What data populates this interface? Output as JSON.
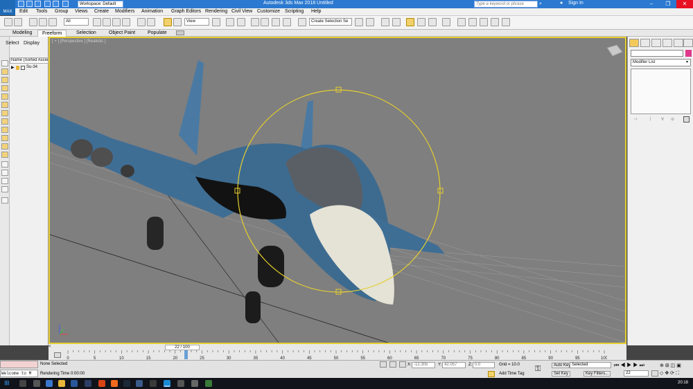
{
  "app": {
    "title": "Autodesk 3ds Max 2018    Untitled",
    "logo_text": "MAX",
    "workspace": "Workspace: Default",
    "search_placeholder": "Type a keyword or phrase",
    "sign_in": "Sign In"
  },
  "menu": [
    "Edit",
    "Tools",
    "Group",
    "Views",
    "Create",
    "Modifiers",
    "Animation",
    "Graph Editors",
    "Rendering",
    "Civil View",
    "Customize",
    "Scripting",
    "Help"
  ],
  "toolbar": {
    "selection_filter": "All",
    "ref_coord": "View",
    "named_selection": "Create Selection Se"
  },
  "ribbon_tabs": [
    "Modeling",
    "Freeform",
    "Selection",
    "Object Paint",
    "Populate"
  ],
  "ribbon_active": "Freeform",
  "scene_explorer": {
    "tabs": [
      "Select",
      "Display"
    ],
    "column_header": "Name (Sorted Ascen",
    "items": [
      {
        "name": "Su-34",
        "expanded": false
      }
    ]
  },
  "viewport": {
    "label": "[ + ] [Perspective ] [Realistic ]"
  },
  "command_panel": {
    "modifier_list": "Modifier List",
    "name_value": "",
    "object_color": "#e0398c"
  },
  "timeline": {
    "slider_label": "22 / 100",
    "current_frame": 22,
    "total_frames": 100,
    "tick_labels": [
      "0",
      "5",
      "10",
      "15",
      "20",
      "25",
      "30",
      "35",
      "40",
      "45",
      "50",
      "55",
      "60",
      "65",
      "70",
      "75",
      "80",
      "85",
      "90",
      "95",
      "100"
    ]
  },
  "status": {
    "maxscript_output": "Welcome to M",
    "selection": "None Selected",
    "rendering_time": "Rendering Time  0:00:00",
    "x_label": "X:",
    "x_value": "-12.305",
    "y_label": "Y:",
    "y_value": "42.057",
    "z_label": "Z:",
    "z_value": "0.0",
    "grid": "Grid = 10.0",
    "add_time_tag": "Add Time Tag",
    "auto_key": "Auto Key",
    "set_key": "Set Key",
    "key_mode": "Selected",
    "key_filters": "Key Filters...",
    "frame_field": "22"
  },
  "taskbar": {
    "clock": "20:18"
  },
  "colors": {
    "titlebar": "#2b79d0",
    "viewport_border": "#e6cf2e",
    "viewport_bg": "#7f7f7f",
    "gizmo": "#e6cf2e"
  }
}
